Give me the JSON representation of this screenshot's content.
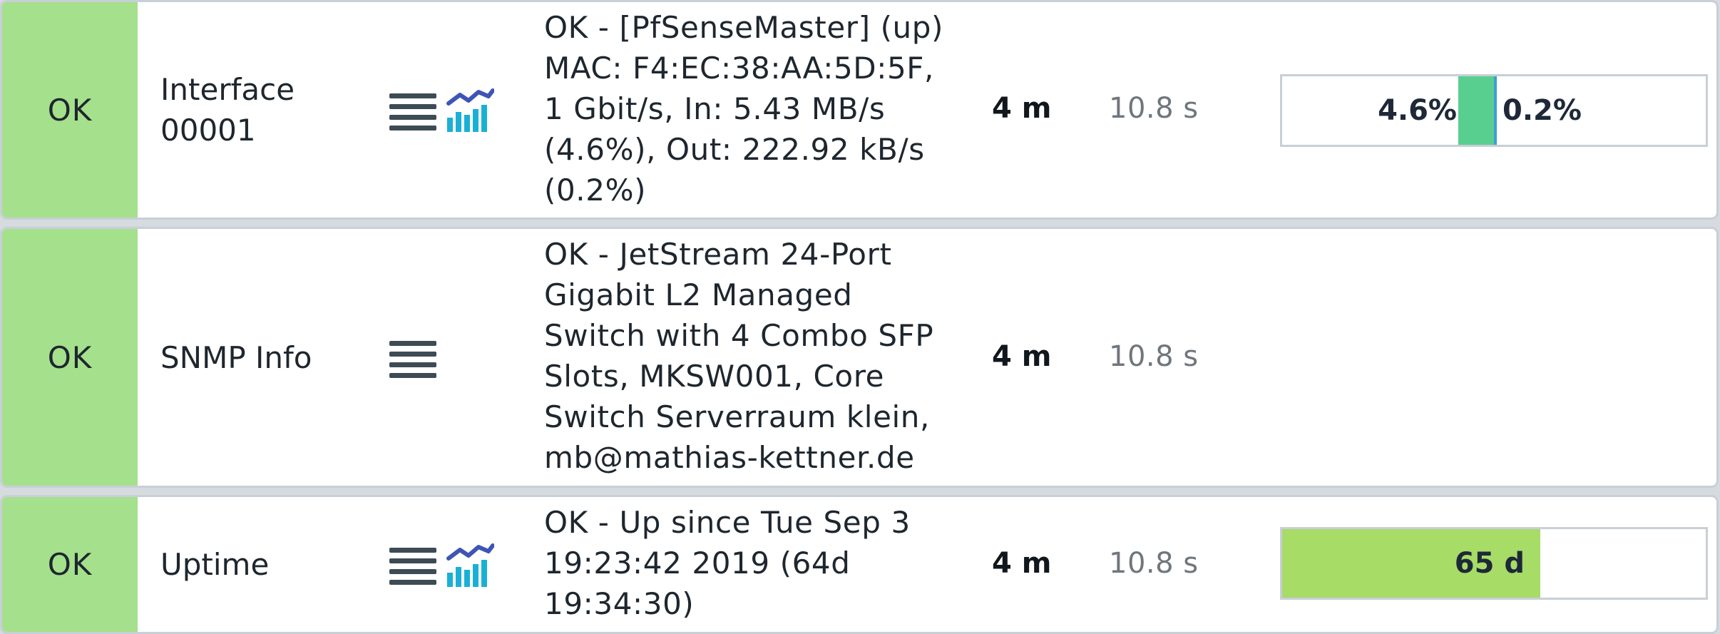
{
  "colors": {
    "state_ok": "#a5e08c",
    "if_in": "#58cf8f",
    "if_out": "#3b9fd6",
    "uptime_bar": "#a7dc67"
  },
  "rows": [
    {
      "state": "OK",
      "service": "Interface\n00001",
      "icons": [
        "menu-icon",
        "graph-icon"
      ],
      "output": "OK - [PfSenseMaster] (up)\nMAC: F4:EC:38:AA:5D:5F,\n1 Gbit/s, In: 5.43 MB/s\n(4.6%), Out: 222.92 kB/s\n(0.2%)",
      "age": "4 m",
      "check_duration": "10.8 s",
      "perfometer": {
        "in_label": "4.6%",
        "out_label": "0.2%",
        "in_percent": 4.6,
        "out_percent": 0.2
      }
    },
    {
      "state": "OK",
      "service": "SNMP Info",
      "icons": [
        "menu-icon"
      ],
      "output": "OK - JetStream 24-Port\nGigabit L2 Managed\nSwitch with 4 Combo SFP\nSlots, MKSW001, Core\nSwitch Serverraum klein,\nmb@mathias-kettner.de",
      "age": "4 m",
      "check_duration": "10.8 s"
    },
    {
      "state": "OK",
      "service": "Uptime",
      "icons": [
        "menu-icon",
        "graph-icon"
      ],
      "output": "OK - Up since Tue Sep 3\n19:23:42 2019 (64d\n19:34:30)",
      "age": "4 m",
      "check_duration": "10.8 s",
      "perfometer": {
        "label": "65 d",
        "fill_fraction": 0.61
      }
    }
  ]
}
